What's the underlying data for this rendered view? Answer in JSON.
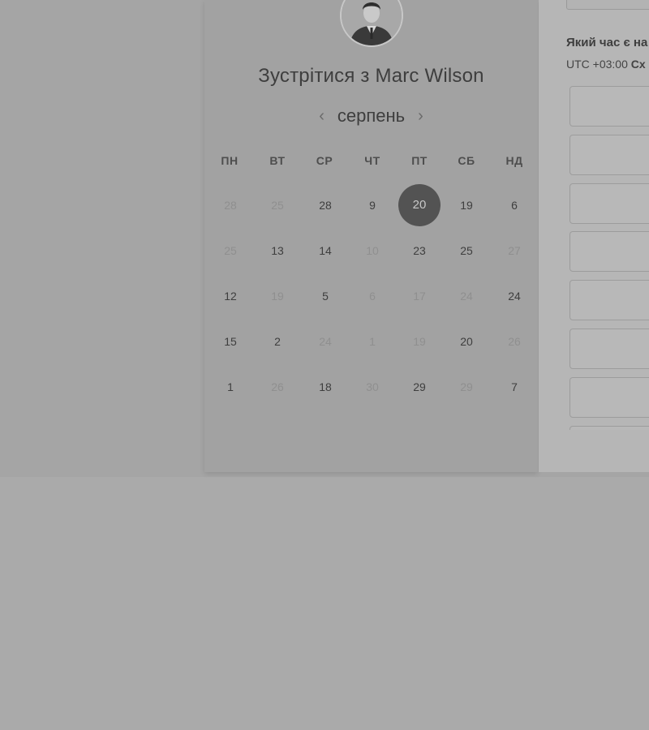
{
  "header": {
    "title": "Зустрітися з Marc Wilson"
  },
  "calendar": {
    "month": "серпень",
    "prev_icon": "chevron-left-icon",
    "next_icon": "chevron-right-icon",
    "weekdays": [
      "ПН",
      "ВТ",
      "СР",
      "ЧТ",
      "ПТ",
      "СБ",
      "НД"
    ],
    "weeks": [
      [
        {
          "d": "28",
          "m": true
        },
        {
          "d": "25",
          "m": true
        },
        {
          "d": "28",
          "m": false
        },
        {
          "d": "9",
          "m": false
        },
        {
          "d": "20",
          "m": false,
          "selected": true
        },
        {
          "d": "19",
          "m": false
        },
        {
          "d": "6",
          "m": false
        }
      ],
      [
        {
          "d": "25",
          "m": true
        },
        {
          "d": "13",
          "m": false
        },
        {
          "d": "14",
          "m": false
        },
        {
          "d": "10",
          "m": true
        },
        {
          "d": "23",
          "m": false
        },
        {
          "d": "25",
          "m": false
        },
        {
          "d": "27",
          "m": true
        }
      ],
      [
        {
          "d": "12",
          "m": false
        },
        {
          "d": "19",
          "m": true
        },
        {
          "d": "5",
          "m": false
        },
        {
          "d": "6",
          "m": true
        },
        {
          "d": "17",
          "m": true
        },
        {
          "d": "24",
          "m": true
        },
        {
          "d": "24",
          "m": false
        }
      ],
      [
        {
          "d": "15",
          "m": false
        },
        {
          "d": "2",
          "m": false
        },
        {
          "d": "24",
          "m": true
        },
        {
          "d": "1",
          "m": true
        },
        {
          "d": "19",
          "m": true
        },
        {
          "d": "20",
          "m": false
        },
        {
          "d": "26",
          "m": true
        }
      ],
      [
        {
          "d": "1",
          "m": false
        },
        {
          "d": "26",
          "m": true
        },
        {
          "d": "18",
          "m": false
        },
        {
          "d": "30",
          "m": true
        },
        {
          "d": "29",
          "m": false
        },
        {
          "d": "29",
          "m": true
        },
        {
          "d": "7",
          "m": false
        }
      ]
    ]
  },
  "times": {
    "question": "Який час є на",
    "timezone_prefix": "UTC +03:00",
    "timezone_suffix": "Сх",
    "slot_count": 8
  },
  "colors": {
    "selected_day": "#535353",
    "overlay": "#aaaaaa"
  }
}
